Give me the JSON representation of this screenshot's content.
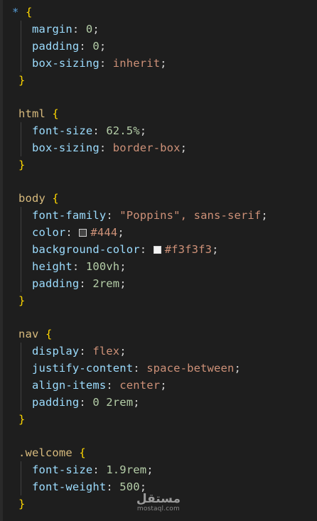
{
  "editor": {
    "language": "css",
    "theme_colors": {
      "background": "#1e1e1e",
      "selector": "#d7ba7d",
      "universal_selector": "#569cd6",
      "brace": "#ffd700",
      "property": "#9cdcfe",
      "string_value": "#ce9178",
      "number_value": "#b5cea8"
    },
    "lines": {
      "l1_sel": "*",
      "l1_brace": "{",
      "l2_prop": "margin",
      "l2_val": "0",
      "l3_prop": "padding",
      "l3_val": "0",
      "l4_prop": "box-sizing",
      "l4_val": "inherit",
      "l5_brace": "}",
      "l7_sel": "html",
      "l7_brace": "{",
      "l8_prop": "font-size",
      "l8_val": "62.5%",
      "l9_prop": "box-sizing",
      "l9_val": "border-box",
      "l10_brace": "}",
      "l12_sel": "body",
      "l12_brace": "{",
      "l13_prop": "font-family",
      "l13_val": "\"Poppins\", sans-serif",
      "l14_prop": "color",
      "l14_val": "#444",
      "l14_swatch": "#444444",
      "l15_prop": "background-color",
      "l15_val": "#f3f3f3",
      "l15_swatch": "#f3f3f3",
      "l16_prop": "height",
      "l16_val": "100vh",
      "l17_prop": "padding",
      "l17_val": "2rem",
      "l18_brace": "}",
      "l20_sel": "nav",
      "l20_brace": "{",
      "l21_prop": "display",
      "l21_val": "flex",
      "l22_prop": "justify-content",
      "l22_val": "space-between",
      "l23_prop": "align-items",
      "l23_val": "center",
      "l24_prop": "padding",
      "l24_val": "0 2rem",
      "l25_brace": "}",
      "l27_sel": ".welcome",
      "l27_brace": "{",
      "l28_prop": "font-size",
      "l28_val": "1.9rem",
      "l29_prop": "font-weight",
      "l29_val": "500",
      "l30_brace": "}"
    }
  },
  "watermark": {
    "main": "مستقل",
    "sub": "mostaql.com"
  }
}
